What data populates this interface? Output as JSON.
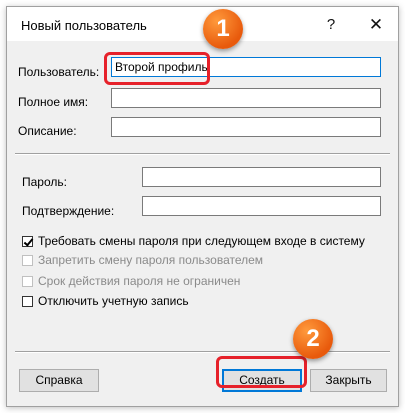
{
  "window": {
    "title": "Новый пользователь",
    "help_glyph": "?",
    "close_glyph": "✕"
  },
  "form": {
    "username": {
      "label": "Пользователь:",
      "value": "Второй профиль"
    },
    "fullname": {
      "label": "Полное имя:",
      "value": ""
    },
    "description": {
      "label": "Описание:",
      "value": ""
    },
    "password": {
      "label": "Пароль:",
      "value": ""
    },
    "confirm": {
      "label": "Подтверждение:",
      "value": ""
    }
  },
  "options": [
    {
      "label": "Требовать смены пароля при следующем входе в систему",
      "checked": true,
      "enabled": true
    },
    {
      "label": "Запретить смену пароля пользователем",
      "checked": false,
      "enabled": false
    },
    {
      "label": "Срок действия пароля не ограничен",
      "checked": false,
      "enabled": false
    },
    {
      "label": "Отключить учетную запись",
      "checked": false,
      "enabled": true
    }
  ],
  "buttons": {
    "help": "Справка",
    "create": "Создать",
    "close": "Закрыть"
  },
  "annotations": {
    "step1": "1",
    "step2": "2",
    "marker_color": "#e6212a",
    "badge_color": "#f07520"
  }
}
